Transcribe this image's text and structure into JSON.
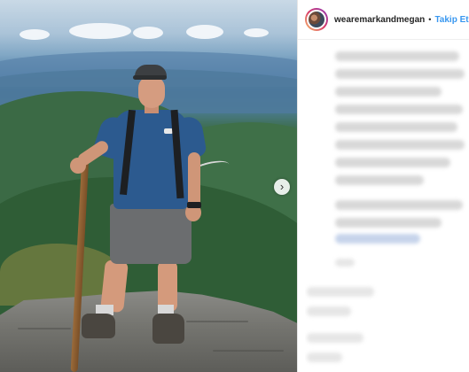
{
  "post": {
    "username": "wearemarkandmegan",
    "separator": "•",
    "follow_label": "Takip Et",
    "next_glyph": "›",
    "icons": {
      "next": "chevron-right-icon",
      "avatar": "profile-avatar"
    },
    "colors": {
      "follow": "#3897f0",
      "username": "#262626",
      "divider": "#e6e6e6"
    }
  }
}
